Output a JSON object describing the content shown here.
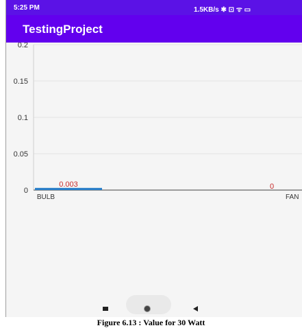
{
  "status_bar": {
    "time": "5:25 PM",
    "indicators": "1.5KB/s ✱ ⊡ ᯤ ▭"
  },
  "app": {
    "title": "TestingProject"
  },
  "chart_data": {
    "type": "bar",
    "categories": [
      "BULB",
      "FAN"
    ],
    "values": [
      0.003,
      0
    ],
    "value_labels": [
      "0.003",
      "0"
    ],
    "ylim": [
      0,
      0.2
    ],
    "yticks": [
      0,
      0.05,
      0.1,
      0.15,
      0.2
    ],
    "ytick_labels": [
      "0",
      "0.05",
      "0.1",
      "0.15",
      "0.2"
    ],
    "grid": true,
    "bar_color": "#2a7fc9",
    "value_label_color": "#c62828"
  },
  "nav_bar": {
    "icons": [
      "recents-icon",
      "home-icon",
      "back-icon"
    ]
  },
  "caption": "Figure 6.13 : Value for 30 Watt"
}
